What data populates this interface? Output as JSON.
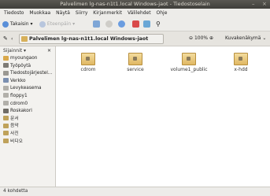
{
  "window": {
    "title": "Palvelimen lg-nas-n1t1.local Windows-jaot - Tiedostoselain",
    "controls": [
      "–",
      "×"
    ]
  },
  "menubar": [
    "Tiedosto",
    "Muokkaa",
    "Näytä",
    "Siirry",
    "Kirjanmerkit",
    "Välilehdet",
    "Ohje"
  ],
  "toolbar": {
    "back_label": "Takaisin",
    "forward_label": "Eteenpäin"
  },
  "location": {
    "path": "Palvelimen lg-nas-n1t1.local Windows-jaot",
    "zoom": "100%",
    "view": "Kuvakenäkymä"
  },
  "sidebar": {
    "header": "Sijainnit",
    "items": [
      {
        "label": "myoungaon",
        "icon": "home-icon",
        "color": "#d9a84a"
      },
      {
        "label": "Työpöytä",
        "icon": "desktop-icon",
        "color": "#7d7a74"
      },
      {
        "label": "Tiedostojärjestel...",
        "icon": "filesystem-icon",
        "color": "#9a9892"
      },
      {
        "label": "Verkko",
        "icon": "network-icon",
        "color": "#7a8fb0"
      },
      {
        "label": "Levykeasema",
        "icon": "drive-icon",
        "color": "#b2b0aa"
      },
      {
        "label": "floppy1",
        "icon": "floppy-icon",
        "color": "#b2b0aa"
      },
      {
        "label": "cdrom0",
        "icon": "cdrom-icon",
        "color": "#b2b0aa"
      },
      {
        "label": "Roskakori",
        "icon": "trash-icon",
        "color": "#6f6c66"
      },
      {
        "label": "문서",
        "icon": "folder-icon",
        "color": "#bfa25a"
      },
      {
        "label": "음악",
        "icon": "folder-icon",
        "color": "#bfa25a"
      },
      {
        "label": "사진",
        "icon": "folder-icon",
        "color": "#bfa25a"
      },
      {
        "label": "비디오",
        "icon": "folder-icon",
        "color": "#bfa25a"
      }
    ]
  },
  "files": [
    {
      "label": "cdrom",
      "icon": "share-folder-icon"
    },
    {
      "label": "service",
      "icon": "share-folder-icon"
    },
    {
      "label": "volume1_public",
      "icon": "share-folder-icon"
    },
    {
      "label": "x-hdd",
      "icon": "share-folder-icon"
    }
  ],
  "status": "4 kohdetta"
}
